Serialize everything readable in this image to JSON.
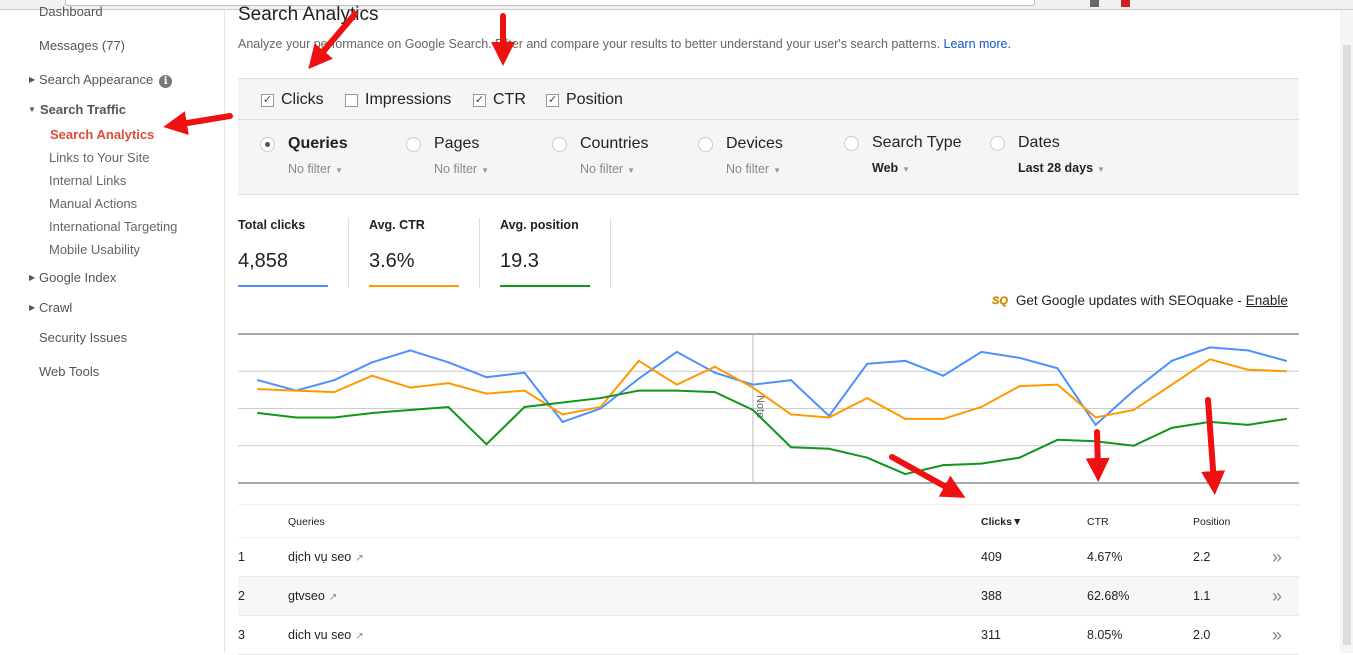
{
  "sidebar": {
    "items": [
      {
        "label": "Dashboard"
      },
      {
        "label": "Messages (77)"
      },
      {
        "label": "Search Appearance"
      },
      {
        "label": "Search Traffic"
      },
      {
        "label": "Search Analytics"
      },
      {
        "label": "Links to Your Site"
      },
      {
        "label": "Internal Links"
      },
      {
        "label": "Manual Actions"
      },
      {
        "label": "International Targeting"
      },
      {
        "label": "Mobile Usability"
      },
      {
        "label": "Google Index"
      },
      {
        "label": "Crawl"
      },
      {
        "label": "Security Issues"
      },
      {
        "label": "Web Tools"
      }
    ],
    "info_glyph": "i"
  },
  "header": {
    "title": "Search Analytics",
    "description": "Analyze your performance on Google Search. Filter and compare your results to better understand your user's search patterns.",
    "learn_more": "Learn more."
  },
  "metrics_toggle": [
    {
      "label": "Clicks",
      "checked": true
    },
    {
      "label": "Impressions",
      "checked": false
    },
    {
      "label": "CTR",
      "checked": true
    },
    {
      "label": "Position",
      "checked": true
    }
  ],
  "dimensions": [
    {
      "label": "Queries",
      "filter": "No filter",
      "selected": true
    },
    {
      "label": "Pages",
      "filter": "No filter"
    },
    {
      "label": "Countries",
      "filter": "No filter"
    },
    {
      "label": "Devices",
      "filter": "No filter"
    },
    {
      "label": "Search Type",
      "filter": "Web"
    },
    {
      "label": "Dates",
      "filter": "Last 28 days"
    }
  ],
  "summary": [
    {
      "label": "Total clicks",
      "value": "4,858",
      "color": "#4d90fe"
    },
    {
      "label": "Avg. CTR",
      "value": "3.6%",
      "color": "#ff9900"
    },
    {
      "label": "Avg. position",
      "value": "19.3",
      "color": "#109618"
    }
  ],
  "seoquake": {
    "logo": "SQ",
    "text": "Get Google updates with SEOquake - ",
    "link": "Enable"
  },
  "chart_data": {
    "type": "line",
    "note_label": "Note",
    "note_index": 13,
    "grid": true,
    "ylim": [
      0,
      100
    ],
    "series": [
      {
        "color": "#4d90fe",
        "values": [
          69,
          62,
          69,
          81,
          89,
          81,
          71,
          74,
          41,
          50,
          70,
          88,
          74,
          66,
          69,
          45,
          80,
          82,
          72,
          88,
          84,
          77,
          39,
          62,
          82,
          91,
          89,
          82
        ]
      },
      {
        "color": "#ff9900",
        "values": [
          63,
          62,
          61,
          72,
          64,
          67,
          60,
          62,
          46,
          51,
          82,
          66,
          78,
          64,
          46,
          44,
          57,
          43,
          43,
          51,
          65,
          66,
          44,
          49,
          66,
          83,
          76,
          75
        ]
      },
      {
        "color": "#109618",
        "values": [
          47,
          44,
          44,
          47,
          49,
          51,
          26,
          51,
          54,
          57,
          62,
          62,
          61,
          49,
          24,
          23,
          17,
          6,
          12,
          13,
          17,
          29,
          28,
          25,
          37,
          41,
          39,
          43
        ]
      }
    ]
  },
  "table": {
    "headers": {
      "queries": "Queries",
      "clicks": "Clicks",
      "sort_indicator": "▼",
      "ctr": "CTR",
      "position": "Position"
    },
    "rows": [
      {
        "rank": "1",
        "query": "dịch vụ seo",
        "clicks": "409",
        "ctr": "4.67%",
        "position": "2.2"
      },
      {
        "rank": "2",
        "query": "gtvseo",
        "clicks": "388",
        "ctr": "62.68%",
        "position": "1.1"
      },
      {
        "rank": "3",
        "query": "dich vu seo",
        "clicks": "311",
        "ctr": "8.05%",
        "position": "2.0"
      }
    ],
    "external_glyph": "↗",
    "more_glyph": "»"
  },
  "annotation_color": "#ee1111"
}
